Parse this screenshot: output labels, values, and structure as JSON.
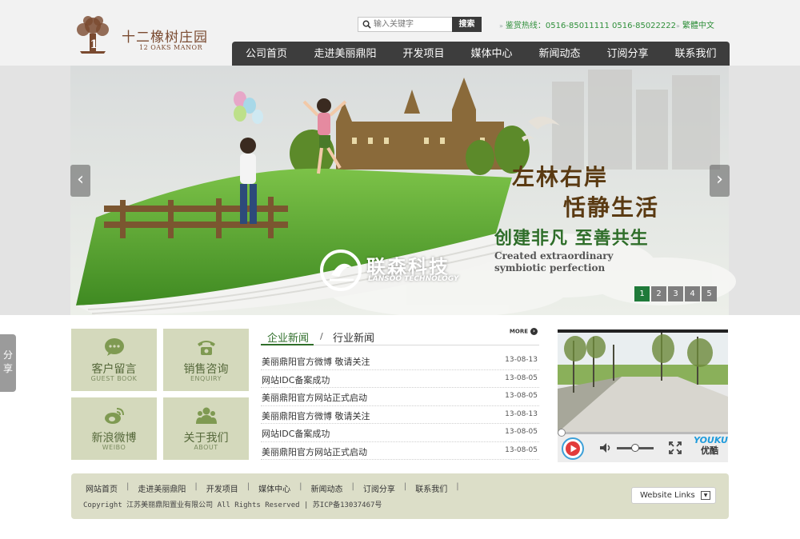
{
  "brand": {
    "name_cn": "十二橡树庄园",
    "name_en": "12 OAKS MANOR",
    "logo_glyph": "1"
  },
  "search": {
    "placeholder": "输入关键字",
    "button_label": "搜索",
    "icon": "search-icon"
  },
  "hotline": {
    "label": "鉴赏热线：",
    "numbers": "0516-85011111 0516-85022222"
  },
  "language": {
    "label": "繁體中文"
  },
  "nav": {
    "items": [
      {
        "label": "公司首页"
      },
      {
        "label": "走进美丽鼎阳"
      },
      {
        "label": "开发项目"
      },
      {
        "label": "媒体中心"
      },
      {
        "label": "新闻动态"
      },
      {
        "label": "订阅分享"
      },
      {
        "label": "联系我们"
      }
    ]
  },
  "banner": {
    "slogan_line1": "左林右岸",
    "slogan_line2": "恬静生活",
    "slogan_line3": "创建非凡  至善共生",
    "slogan_en1": "Created extraordinary",
    "slogan_en2": "symbiotic perfection",
    "watermark_cn": "联森科技",
    "watermark_en": "LANSOO TECHNOLOGY",
    "prev_glyph": "‹",
    "next_glyph": "›",
    "pages": [
      "1",
      "2",
      "3",
      "4",
      "5"
    ],
    "active_page": "1"
  },
  "share": {
    "label": "分享"
  },
  "tiles": [
    {
      "cn": "客户留言",
      "en": "GUEST BOOK",
      "icon": "chat-bubble-icon"
    },
    {
      "cn": "销售咨询",
      "en": "ENQUIRY",
      "icon": "telephone-icon"
    },
    {
      "cn": "新浪微博",
      "en": "WEIBO",
      "icon": "weibo-icon"
    },
    {
      "cn": "关于我们",
      "en": "ABOUT",
      "icon": "people-icon"
    }
  ],
  "news": {
    "tab_active": "企业新闻",
    "separator": "/",
    "tab_other": "行业新闻",
    "more_label": "MORE",
    "more_glyph": "›",
    "items": [
      {
        "title": "美丽鼎阳官方微博  敬请关注",
        "date": "13-08-13"
      },
      {
        "title": "网站IDC备案成功",
        "date": "13-08-05"
      },
      {
        "title": "美丽鼎阳官方网站正式启动",
        "date": "13-08-05"
      },
      {
        "title": "美丽鼎阳官方微博  敬请关注",
        "date": "13-08-13"
      },
      {
        "title": "网站IDC备案成功",
        "date": "13-08-05"
      },
      {
        "title": "美丽鼎阳官方网站正式启动",
        "date": "13-08-05"
      }
    ]
  },
  "video": {
    "brand_logo": "YOUKU",
    "brand_cn": "优酷",
    "volume_level": 0.5,
    "progress": 0.0
  },
  "footer": {
    "links": [
      "网站首页",
      "走进美丽鼎阳",
      "开发项目",
      "媒体中心",
      "新闻动态",
      "订阅分享",
      "联系我们"
    ],
    "separator": "|",
    "copyright": "Copyright 江苏美丽鼎阳置业有限公司 All Rights Reserved | 苏ICP备13037467号",
    "website_links_label": "Website Links",
    "dropdown_glyph": "▼"
  },
  "colors": {
    "accent_green": "#2f6e2a",
    "nav_bg": "#3d3d3d",
    "tile_bg": "#d4d9bc",
    "footer_bg": "#dcdec8",
    "pager_active": "#1f7a3a"
  }
}
